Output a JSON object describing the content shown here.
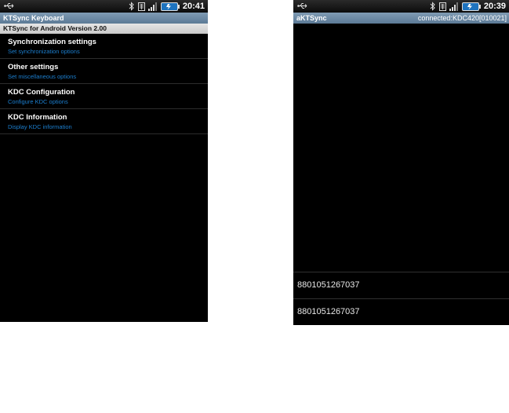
{
  "left_screen": {
    "status": {
      "time": "20:41"
    },
    "title": "KTSync Keyboard",
    "version": "KTSync for Android Version 2.00",
    "items": [
      {
        "title": "Synchronization settings",
        "summary": "Set synchronization options"
      },
      {
        "title": "Other settings",
        "summary": "Set miscellaneous options"
      },
      {
        "title": "KDC Configuration",
        "summary": "Configure KDC options"
      },
      {
        "title": "KDC Information",
        "summary": "Display KDC information"
      }
    ]
  },
  "right_screen": {
    "status": {
      "time": "20:39"
    },
    "title": "aKTSync",
    "connection": "connected:KDC420[010021]",
    "scans": [
      "8801051267037",
      "8801051267037"
    ]
  },
  "icons": {
    "usb": "usb-icon",
    "bluetooth": "bluetooth-icon",
    "sim": "sim-icon",
    "signal": "signal-icon",
    "battery": "battery-icon"
  },
  "colors": {
    "title_bar": "#6b88a4",
    "summary_text": "#1c7fcf",
    "background": "#000000"
  }
}
